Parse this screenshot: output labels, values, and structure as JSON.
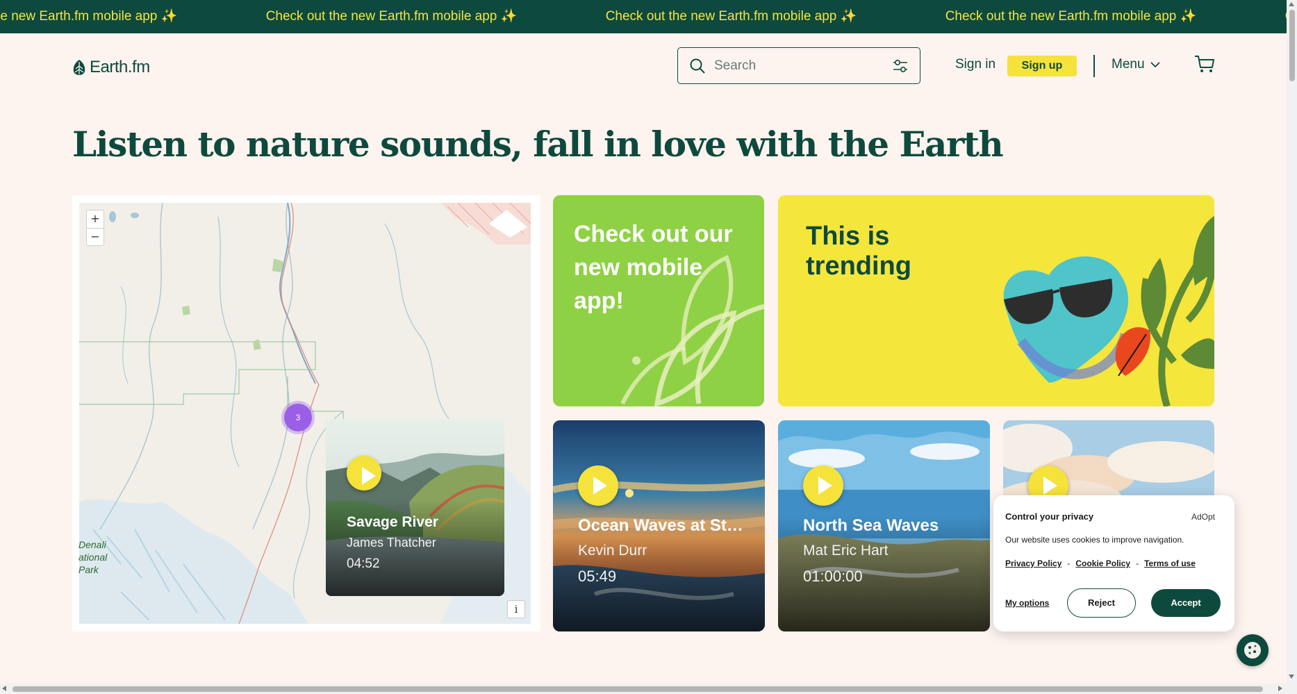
{
  "announcement": {
    "messages": [
      "Check out the new Earth.fm mobile app ✨",
      "Check out the new Earth.fm mobile app ✨",
      "Check out the new Earth.fm mobile app ✨",
      "Check out the new Earth.fm mobile app ✨",
      "Check out the new Earth.fm mobile app ✨"
    ]
  },
  "header": {
    "logo_text": "Earth.fm",
    "search_placeholder": "Search",
    "signin_label": "Sign in",
    "signup_label": "Sign up",
    "menu_label": "Menu"
  },
  "hero": {
    "title": "Listen to nature sounds, fall in love with the Earth"
  },
  "map": {
    "zoom_in": "+",
    "zoom_out": "−",
    "cluster_count": "3",
    "park_label_1": "Denali",
    "park_label_2": "ational",
    "park_label_3": "Park",
    "info_label": "i",
    "popup": {
      "title": "Savage River",
      "artist": "James Thatcher",
      "duration": "04:52"
    }
  },
  "tiles": {
    "app_promo": "Check out our new mobile app!",
    "trending": "This is trending"
  },
  "sounds": [
    {
      "title": "Ocean Waves at St…",
      "artist": "Kevin Durr",
      "duration": "05:49"
    },
    {
      "title": "North Sea Waves",
      "artist": "Mat Eric Hart",
      "duration": "01:00:00"
    }
  ],
  "cookie_banner": {
    "title": "Control your privacy",
    "brand": "AdOpt",
    "text": "Our website uses cookies to improve navigation.",
    "links": [
      "Privacy Policy",
      "Cookie Policy",
      "Terms of use"
    ],
    "separator": "-",
    "my_options": "My options",
    "reject": "Reject",
    "accept": "Accept"
  },
  "colors": {
    "brand_green": "#0d4a3d",
    "accent_yellow": "#f5e23a",
    "lime": "#8fd144",
    "cluster_purple": "#9b5ee6"
  },
  "icons": [
    "leaf-logo-icon",
    "search-icon",
    "filter-icon",
    "chevron-down-icon",
    "cart-icon",
    "play-icon",
    "cookie-icon"
  ]
}
